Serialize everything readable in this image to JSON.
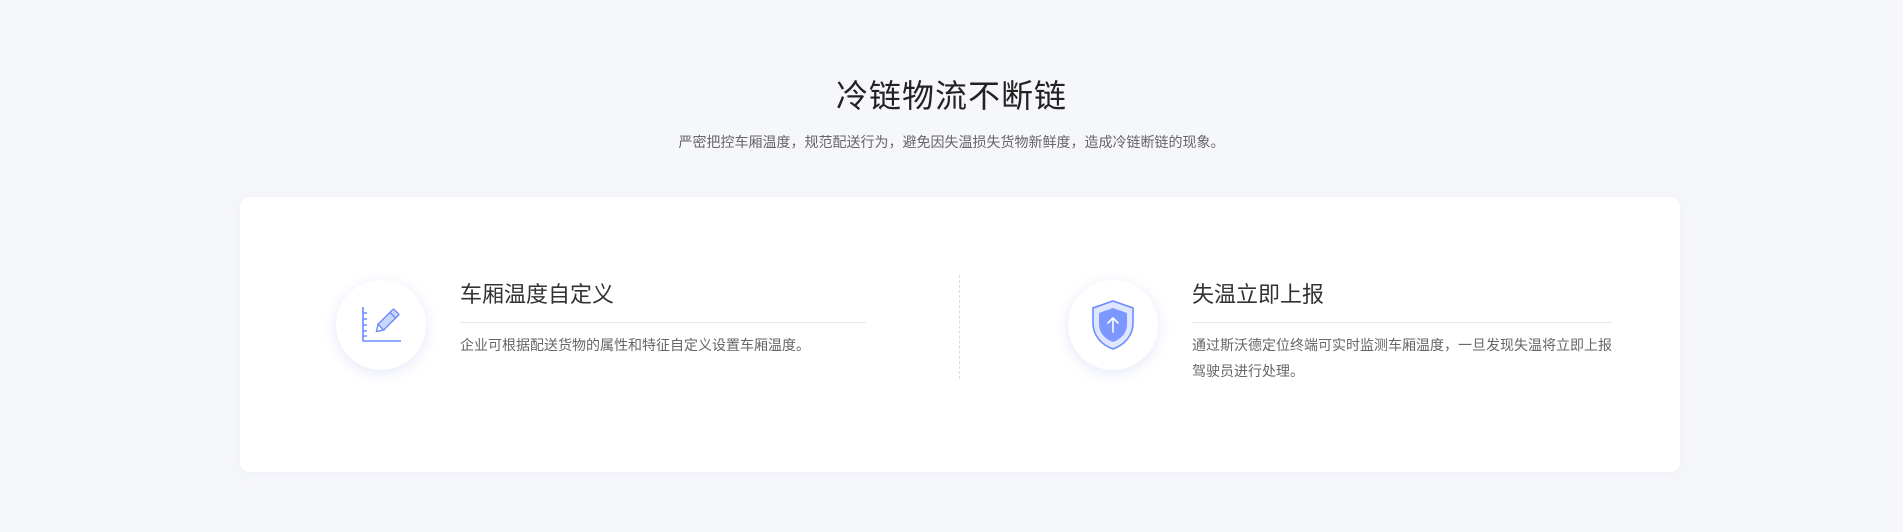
{
  "header": {
    "title": "冷链物流不断链",
    "subtitle": "严密把控车厢温度，规范配送行为，避免因失温损失货物新鲜度，造成冷链断链的现象。"
  },
  "features": [
    {
      "title": "车厢温度自定义",
      "description": "企业可根据配送货物的属性和特征自定义设置车厢温度。",
      "icon": "pencil-ruler-icon"
    },
    {
      "title": "失温立即上报",
      "description": "通过斯沃德定位终端可实时监测车厢温度，一旦发现失温将立即上报驾驶员进行处理。",
      "icon": "shield-upload-icon"
    }
  ],
  "colors": {
    "background": "#f6f7fb",
    "card": "#ffffff",
    "accent": "#6b8cff"
  }
}
